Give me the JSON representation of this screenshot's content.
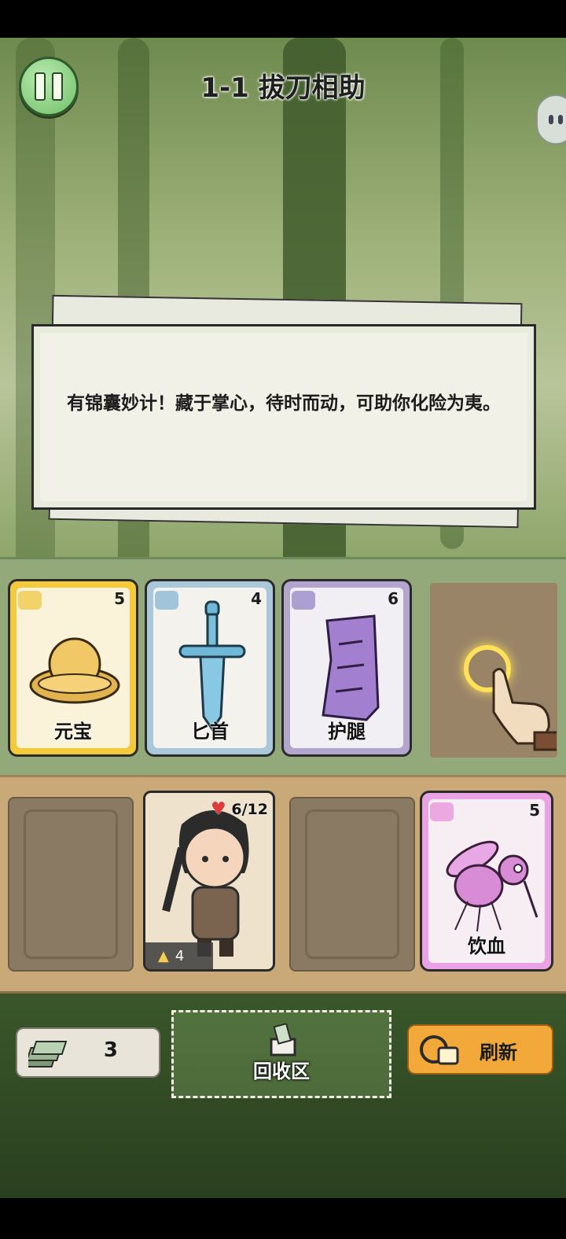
{
  "header": {
    "title": "1-1 拔刀相助"
  },
  "dialog": {
    "text": "有锦囊妙计！藏于掌心，待时而动，可助你化险为夷。"
  },
  "shop_cards": [
    {
      "name": "元宝",
      "value": "5",
      "icon": "gold-ingot-icon",
      "frame_color": "#f4c93a"
    },
    {
      "name": "匕首",
      "value": "4",
      "icon": "dagger-icon",
      "frame_color": "#a9c8da"
    },
    {
      "name": "护腿",
      "value": "6",
      "icon": "leg-guard-icon",
      "frame_color": "#b2a6cf"
    }
  ],
  "hero": {
    "hp": "6/12",
    "gold": "4"
  },
  "enemy_card": {
    "name": "饮血",
    "value": "5",
    "icon": "mosquito-icon",
    "frame_color": "#e9a2e4"
  },
  "bottom": {
    "deck_count": "3",
    "recycle_label": "回收区",
    "refresh_label": "刷新"
  }
}
